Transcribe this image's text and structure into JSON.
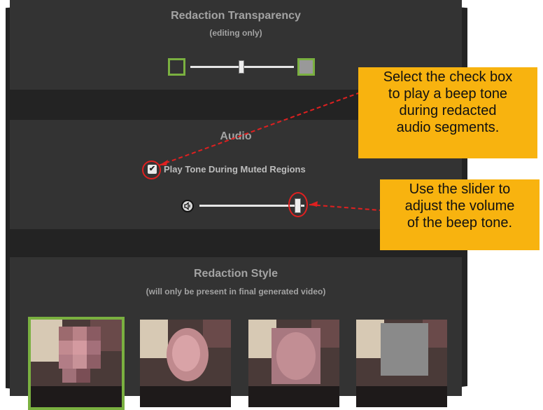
{
  "transparency": {
    "title": "Redaction Transparency",
    "subtitle": "(editing only)",
    "slider_value": 0.5
  },
  "audio": {
    "title": "Audio",
    "checkbox_label": "Play Tone During Muted Regions",
    "checkbox_checked": true,
    "volume_value": 0.93
  },
  "style": {
    "title": "Redaction Style",
    "subtitle": "(will only be present in final generated video)",
    "options": [
      "pixelate",
      "blur-light",
      "blur-heavy",
      "solid-box"
    ],
    "selected_index": 0
  },
  "callouts": {
    "checkbox_note": [
      "Select the check box",
      "to play a beep tone",
      "during redacted",
      "audio segments."
    ],
    "slider_note": [
      "Use the slider to",
      "adjust the volume",
      "of the beep tone."
    ]
  },
  "colors": {
    "selected_border": "#7ab040",
    "callout_bg": "#f8b30f",
    "highlight": "#e02020"
  }
}
